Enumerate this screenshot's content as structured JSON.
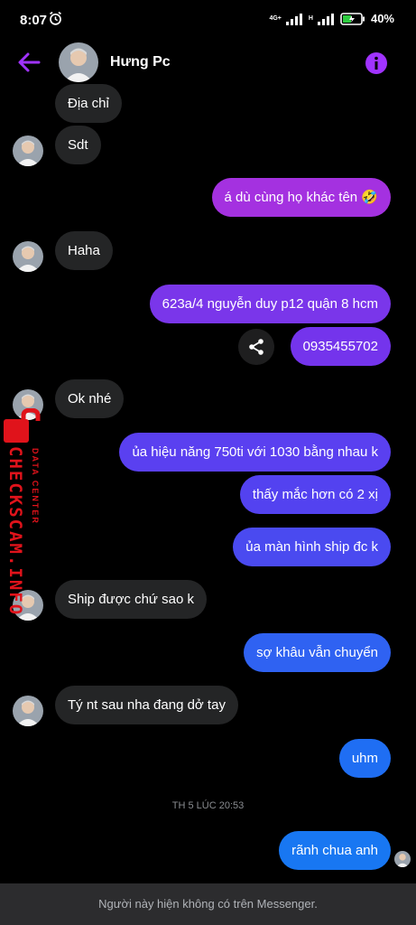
{
  "status_bar": {
    "time": "8:07",
    "network_top": "4G+",
    "network_bottom": "H",
    "battery": "40%",
    "icons": [
      "alarm-icon",
      "signal-icon",
      "battery-icon"
    ]
  },
  "header": {
    "name": "Hưng Pc",
    "icons": [
      "back-arrow-icon",
      "info-icon"
    ]
  },
  "colors": {
    "accent": "#8a2be2",
    "bubble_incoming": "#242526",
    "bubble_out_top": "#a431e0",
    "bubble_out_mid": "#6a3df0",
    "bubble_out_bottom": "#1877f2",
    "footer_bg": "#2c2c2e"
  },
  "messages": [
    {
      "dir": "in",
      "text": "Địa chỉ"
    },
    {
      "dir": "in",
      "text": "Sdt"
    },
    {
      "dir": "out",
      "text": "á dù cùng họ khác tên 🤣"
    },
    {
      "dir": "in",
      "text": "Haha"
    },
    {
      "dir": "out",
      "text": "623a/4 nguyễn duy p12 quận 8 hcm"
    },
    {
      "dir": "out",
      "text": "0935455702"
    },
    {
      "dir": "in",
      "text": "Ok nhé"
    },
    {
      "dir": "out",
      "text": "ủa hiệu năng 750ti với 1030 bằng nhau k"
    },
    {
      "dir": "out",
      "text": "thấy mắc hơn có 2 xị"
    },
    {
      "dir": "out",
      "text": "ủa màn hình ship đc k"
    },
    {
      "dir": "in",
      "text": "Ship được chứ sao k"
    },
    {
      "dir": "out",
      "text": "sợ khâu vẫn chuyển"
    },
    {
      "dir": "in",
      "text": "Tý nt sau nha đang dở tay"
    },
    {
      "dir": "out",
      "text": "uhm"
    },
    {
      "dir": "out",
      "text": "rãnh chua anh"
    }
  ],
  "timestamp": "TH 5 LÚC 20:53",
  "watermark": {
    "line1": "DATA CENTER",
    "line2": "CHECKSCAM.INFO"
  },
  "footer": {
    "text": "Người này hiện không có trên Messenger."
  }
}
